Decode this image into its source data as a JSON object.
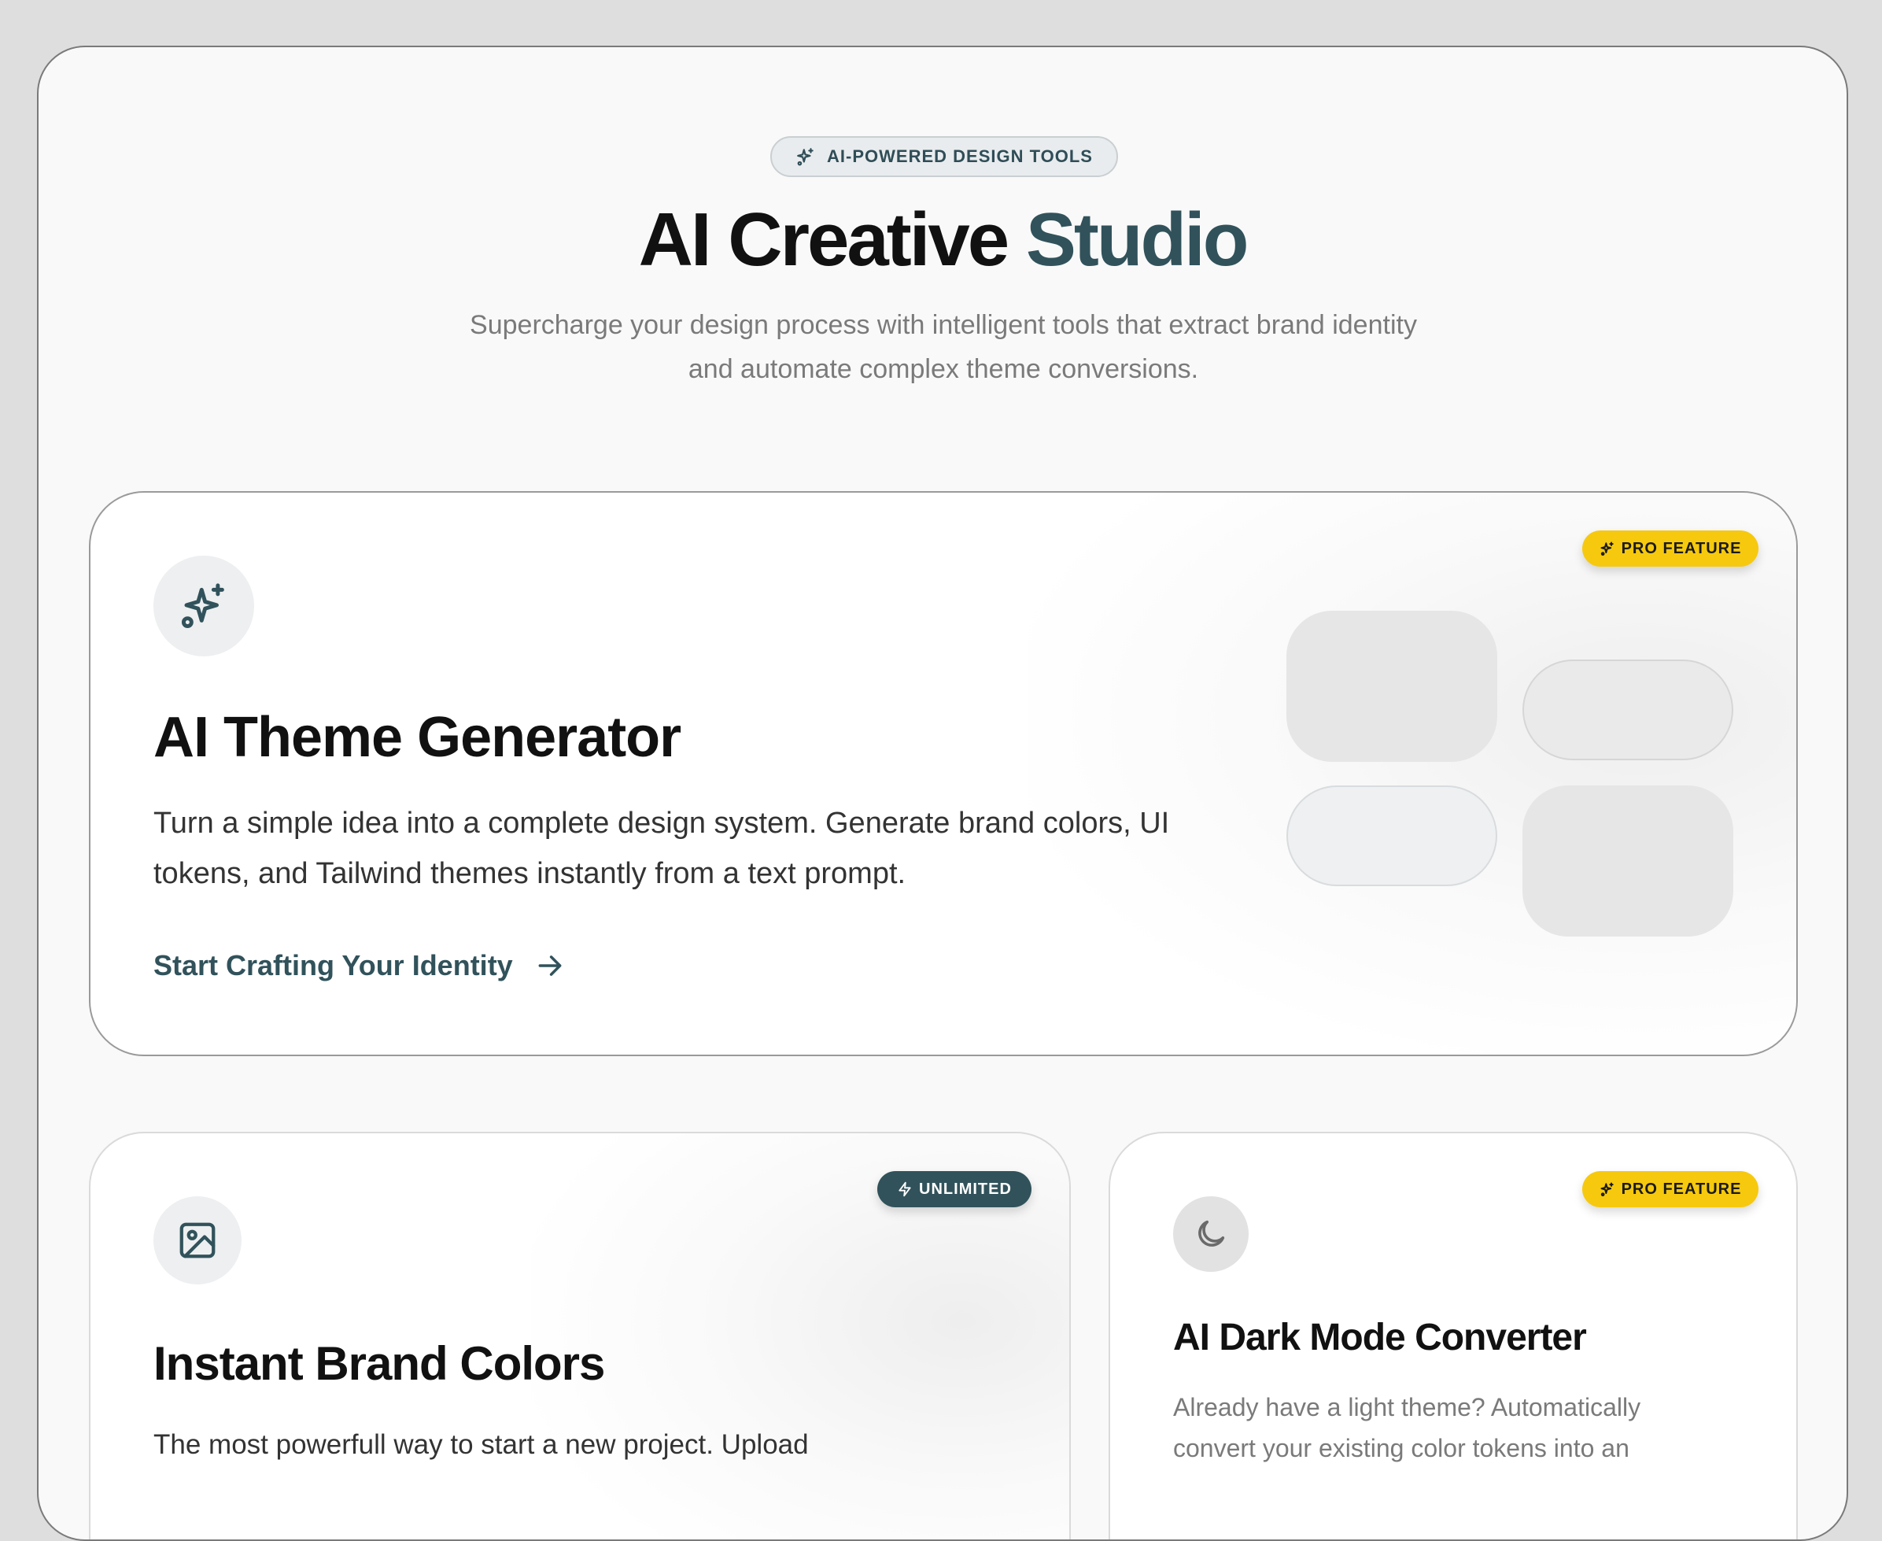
{
  "header": {
    "badge_label": "AI-POWERED DESIGN TOOLS",
    "title_main": "AI Creative",
    "title_accent": "Studio",
    "subtitle_line1": "Supercharge your design process with intelligent tools that extract brand identity",
    "subtitle_line2": "and automate complex theme conversions."
  },
  "cards": {
    "theme_generator": {
      "badge": "PRO FEATURE",
      "title": "AI Theme Generator",
      "desc_line1": "Turn a simple idea into a complete design system. Generate brand colors, UI",
      "desc_line2": "tokens, and Tailwind themes instantly from a text prompt.",
      "cta": "Start Crafting Your Identity",
      "icon": "sparkles-icon"
    },
    "brand_colors": {
      "badge": "UNLIMITED",
      "title": "Instant Brand Colors",
      "desc_line1": "The most powerfull way to start a new project. Upload",
      "icon": "image-icon"
    },
    "dark_mode": {
      "badge": "PRO FEATURE",
      "title": "AI Dark Mode Converter",
      "desc_line1": "Already have a light theme? Automatically",
      "desc_line2": "convert your existing color tokens into an",
      "icon": "moon-icon"
    }
  },
  "colors": {
    "accent": "#31525b",
    "pro_badge": "#f6c90e",
    "background": "#f9f9f9"
  }
}
